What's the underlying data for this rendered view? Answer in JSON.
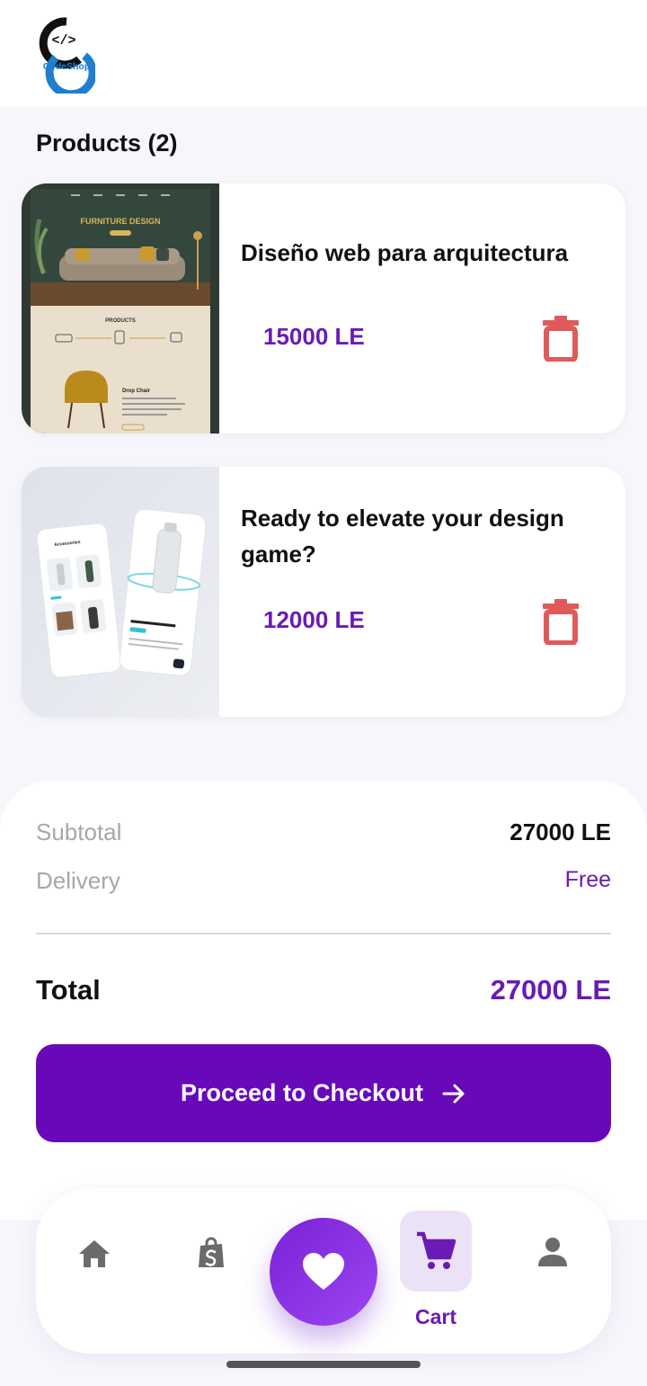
{
  "brand": {
    "logo_text": "CodeShop",
    "logo_symbol": "</>"
  },
  "cart": {
    "title": "Products (2)",
    "items": [
      {
        "title": "Diseño web para arquitectura",
        "price": "15000 LE",
        "thumbnail": {
          "heading": "FURNITURE DESIGN",
          "section": "PRODUCTS",
          "product": "Drop Chair"
        }
      },
      {
        "title": "Ready to elevate your design game?",
        "price": "12000 LE",
        "thumbnail": {
          "caption": "Accessories"
        }
      }
    ]
  },
  "summary": {
    "subtotal_label": "Subtotal",
    "subtotal_value": "27000 LE",
    "delivery_label": "Delivery",
    "delivery_value": "Free",
    "total_label": "Total",
    "total_value": "27000 LE",
    "checkout_label": "Proceed to Checkout"
  },
  "nav": {
    "cart_label": "Cart"
  },
  "icons": [
    "home-icon",
    "shop-bag-icon",
    "heart-icon",
    "cart-icon",
    "person-icon",
    "trash-icon",
    "arrow-right-icon"
  ],
  "colors": {
    "accent": "#6809b9",
    "price": "#6a1bb4",
    "delete": "#e05a5a",
    "cart_bg": "#ece2f8"
  }
}
